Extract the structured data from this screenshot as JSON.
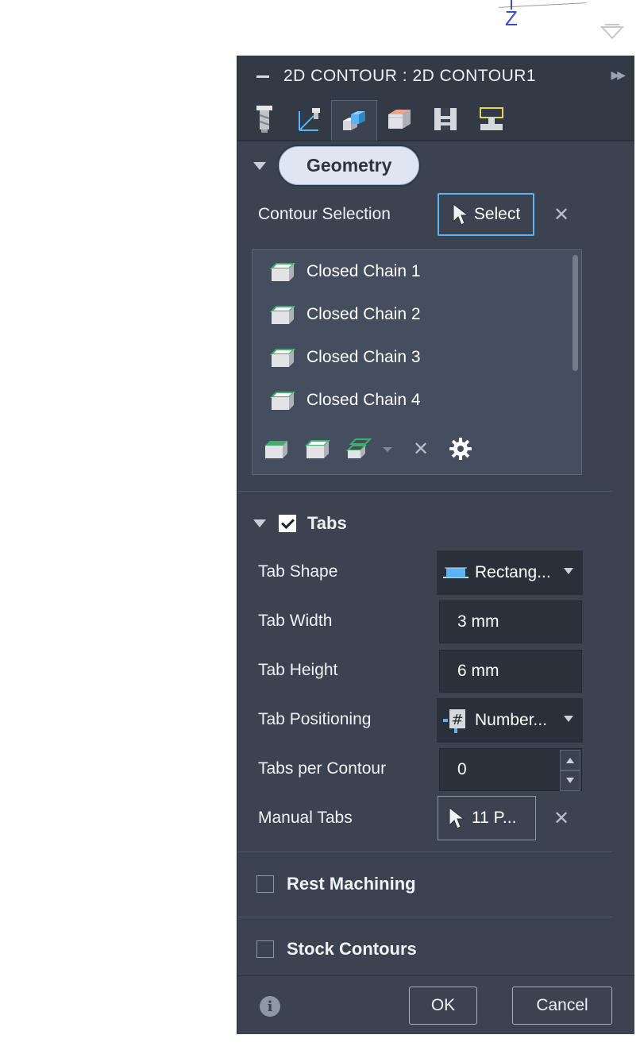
{
  "viewport": {
    "z_axis_label": "Z"
  },
  "panel": {
    "title": "2D CONTOUR : 2D CONTOUR1",
    "tool_tabs": [
      "tool-tab",
      "geometry-axis-tab",
      "geometry-tab",
      "heights-tab",
      "passes-tab",
      "linking-tab"
    ],
    "active_tab": "geometry-tab",
    "geometry_section": {
      "heading": "Geometry",
      "contour_selection_label": "Contour Selection",
      "select_button": "Select",
      "clear_symbol": "✕",
      "chains": [
        "Closed Chain 1",
        "Closed Chain 2",
        "Closed Chain 3",
        "Closed Chain 4"
      ],
      "toolbar_clear_symbol": "✕"
    },
    "tabs_section": {
      "heading": "Tabs",
      "enabled": true,
      "tab_shape_label": "Tab Shape",
      "tab_shape_value": "Rectang...",
      "tab_width_label": "Tab Width",
      "tab_width_value": "3 mm",
      "tab_height_label": "Tab Height",
      "tab_height_value": "6 mm",
      "tab_positioning_label": "Tab Positioning",
      "tab_positioning_value": "Number...",
      "tabs_per_contour_label": "Tabs per Contour",
      "tabs_per_contour_value": "0",
      "manual_tabs_label": "Manual Tabs",
      "manual_tabs_value": "11 P...",
      "clear_symbol": "✕"
    },
    "rest_machining": {
      "label": "Rest Machining",
      "enabled": false
    },
    "stock_contours": {
      "label": "Stock Contours",
      "enabled": false
    },
    "footer": {
      "ok_label": "OK",
      "cancel_label": "Cancel"
    }
  },
  "colors": {
    "panel_bg": "#3b4350",
    "title_bg": "#323a46",
    "accent_blue": "#5ab3f2",
    "chain_green": "#3fae6a"
  }
}
